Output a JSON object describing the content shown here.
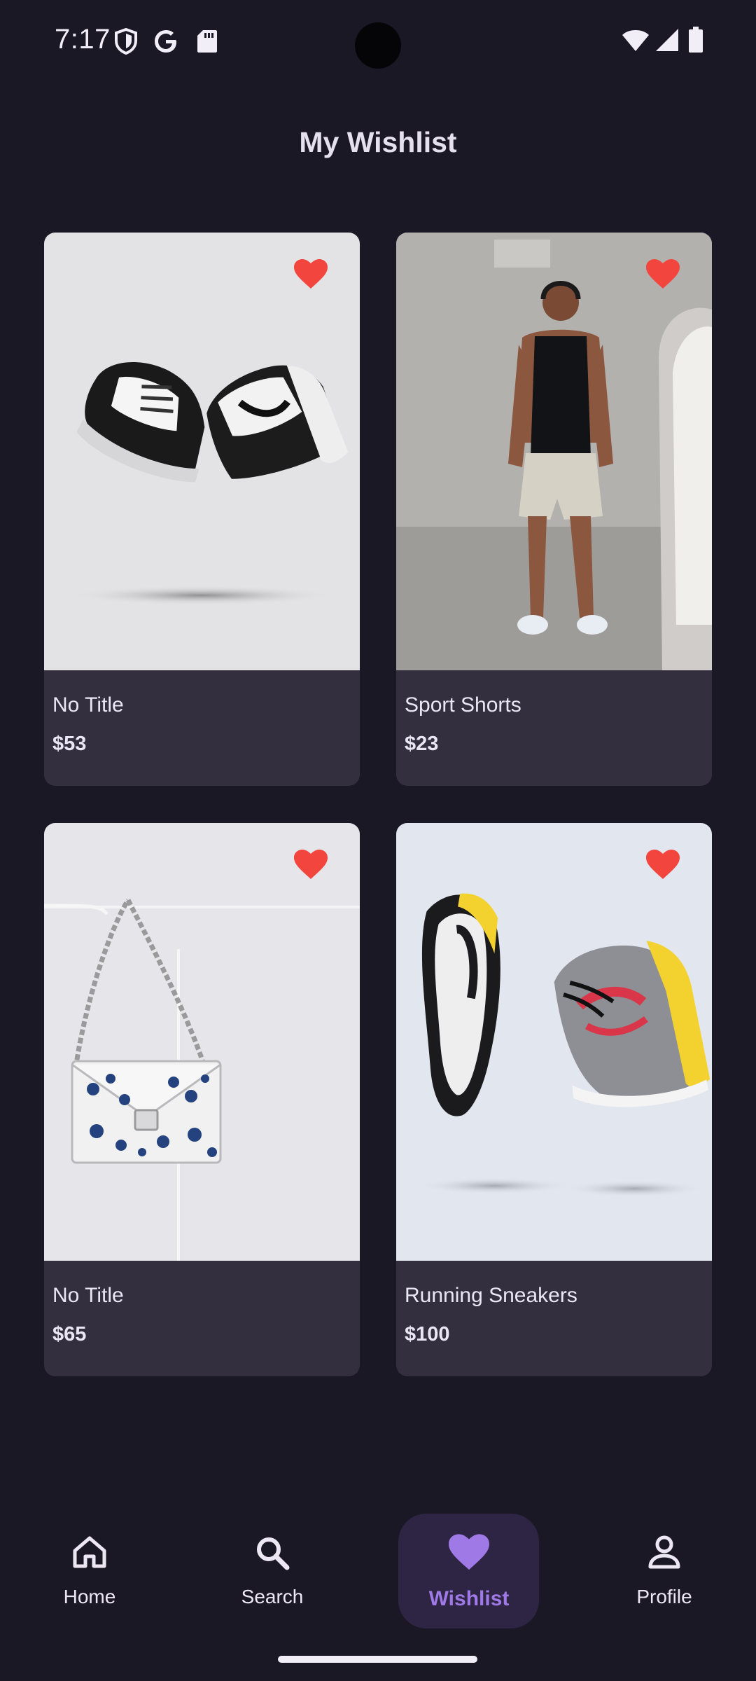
{
  "status_bar": {
    "time": "7:17",
    "left_icons": [
      "shield-icon",
      "google-icon",
      "sd-card-icon"
    ],
    "right_icons": [
      "wifi-icon",
      "signal-icon",
      "battery-icon"
    ]
  },
  "header": {
    "title": "My Wishlist"
  },
  "products": [
    {
      "title": "No Title",
      "price": "$53",
      "image": "black-white-sneakers",
      "favorited": true
    },
    {
      "title": "Sport Shorts",
      "price": "$23",
      "image": "man-in-sport-shorts",
      "favorited": true
    },
    {
      "title": "No Title",
      "price": "$65",
      "image": "floral-chain-handbag",
      "favorited": true
    },
    {
      "title": "Running Sneakers",
      "price": "$100",
      "image": "yellow-grey-running-sneakers",
      "favorited": true
    }
  ],
  "bottom_nav": {
    "items": [
      {
        "label": "Home",
        "icon": "home-icon",
        "active": false
      },
      {
        "label": "Search",
        "icon": "search-icon",
        "active": false
      },
      {
        "label": "Wishlist",
        "icon": "heart-icon",
        "active": true
      },
      {
        "label": "Profile",
        "icon": "profile-icon",
        "active": false
      }
    ]
  },
  "colors": {
    "background": "#1b1826",
    "card": "#332f3f",
    "heart": "#f2453d",
    "accent": "#9f7ae6",
    "nav_active_bg": "#2d2543"
  }
}
